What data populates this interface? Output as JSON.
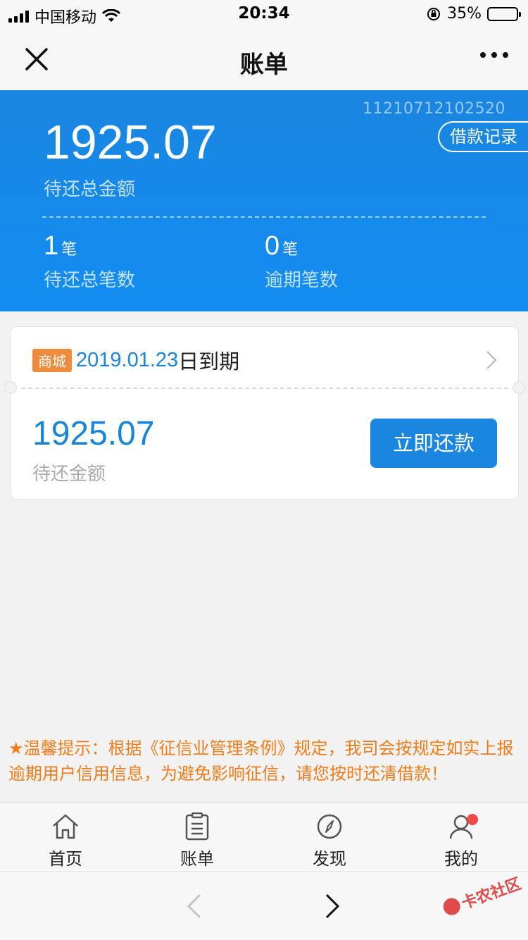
{
  "status_bar": {
    "carrier": "中国移动",
    "time": "20:34",
    "battery_percent": "35%",
    "battery_level": 0.35
  },
  "nav": {
    "title": "账单",
    "close_icon": "close-icon",
    "more_icon": "more-icon"
  },
  "summary": {
    "bill_id": "11210712102520",
    "record_button": "借款记录",
    "total_amount": "1925.07",
    "total_amount_label": "待还总金额",
    "pending_count": "1",
    "pending_unit": "笔",
    "pending_label": "待还总笔数",
    "overdue_count": "0",
    "overdue_unit": "笔",
    "overdue_label": "逾期笔数"
  },
  "bill_card": {
    "tag": "商城",
    "due_date": "2019.01.23",
    "due_suffix": "日到期",
    "amount": "1925.07",
    "amount_label": "待还金额",
    "pay_button": "立即还款"
  },
  "tip": {
    "text": "★温馨提示：根据《征信业管理条例》规定，我司会按规定如实上报逾期用户信用信息，为避免影响征信，请您按时还清借款！"
  },
  "tabs": [
    {
      "label": "首页",
      "icon": "home-icon"
    },
    {
      "label": "账单",
      "icon": "bill-icon"
    },
    {
      "label": "发现",
      "icon": "compass-icon"
    },
    {
      "label": "我的",
      "icon": "user-icon",
      "badge": true
    }
  ],
  "watermark": {
    "text": "卡农社区"
  },
  "colors": {
    "primary": "#1a86e0",
    "accent_orange": "#f08a3c",
    "badge_red": "#f04848"
  }
}
